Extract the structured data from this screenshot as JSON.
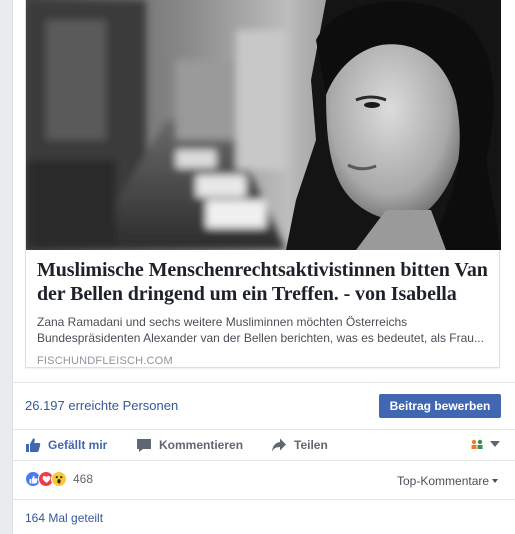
{
  "preview": {
    "headline": "Muslimische Menschenrechtsaktivistinnen bitten Van der Bellen dringend um ein Treffen. - von Isabella",
    "excerpt_line1": "Zana Ramadani und sechs weitere Musliminnen möchten Österreichs",
    "excerpt_line2": "Bundespräsidenten Alexander van der Bellen berichten, was es bedeutet, als Frau...",
    "domain": "FISCHUNDFLEISCH.COM"
  },
  "insights": {
    "reach": "26.197 erreichte Personen",
    "boost_label": "Beitrag bewerben"
  },
  "actions": {
    "like": "Gefällt mir",
    "comment": "Kommentieren",
    "share": "Teilen"
  },
  "reactions": {
    "count": "468",
    "types": [
      "like",
      "love",
      "wow"
    ],
    "sort_label": "Top-Kommentare"
  },
  "shares": "164 Mal geteilt",
  "colors": {
    "link_blue": "#365899",
    "button_blue": "#4267b2",
    "icon_gray": "#606770"
  }
}
